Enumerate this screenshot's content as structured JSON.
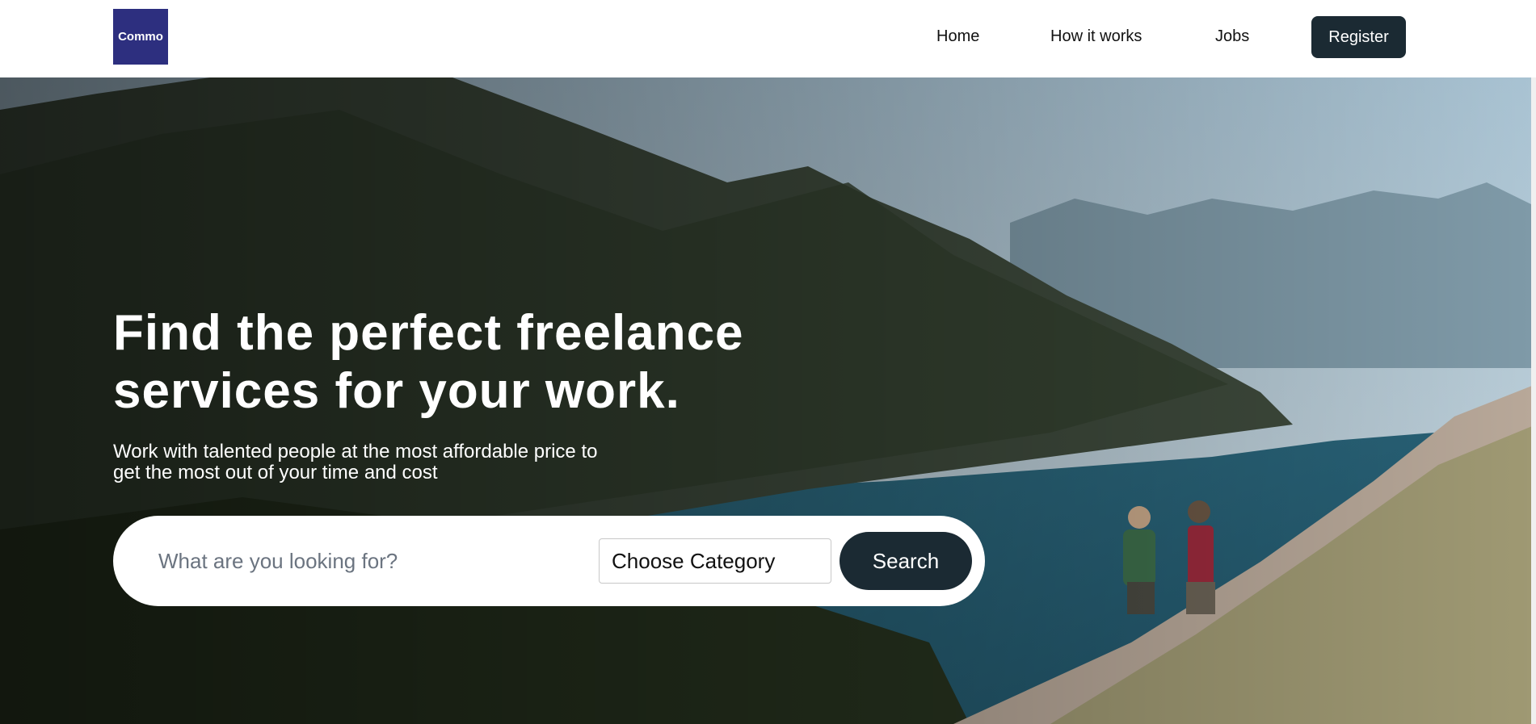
{
  "header": {
    "logo_text": "Commo",
    "nav": {
      "home": "Home",
      "how_it_works": "How it works",
      "jobs": "Jobs"
    },
    "register_label": "Register"
  },
  "hero": {
    "headline_line1": "Find the perfect freelance",
    "headline_line2": "services for your work.",
    "subline_line1": "Work with talented people at the most affordable price to",
    "subline_line2": "get the most out of your time and cost"
  },
  "search": {
    "placeholder": "What are you looking for?",
    "category_selected": "Choose Category",
    "button_label": "Search"
  },
  "colors": {
    "brand": "#2d2f7f",
    "accent": "#1b2a33"
  }
}
